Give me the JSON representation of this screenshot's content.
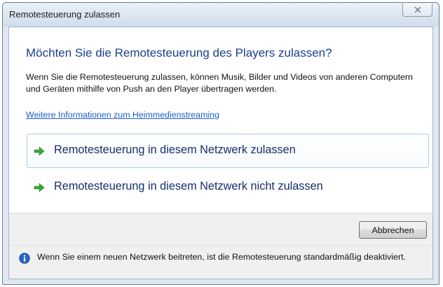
{
  "window": {
    "title": "Remotesteuerung zulassen",
    "close_icon": "close-icon"
  },
  "main": {
    "heading": "Möchten Sie die Remotesteuerung des Players zulassen?",
    "description": "Wenn Sie die Remotesteuerung zulassen, können Musik, Bilder und Videos von anderen Computern und Geräten mithilfe von Push an den Player übertragen werden.",
    "info_link": "Weitere Informationen zum Heimmedienstreaming",
    "options": [
      {
        "label": "Remotesteuerung in diesem Netzwerk zulassen",
        "icon": "green-arrow-icon"
      },
      {
        "label": "Remotesteuerung in diesem Netzwerk nicht zulassen",
        "icon": "green-arrow-icon"
      }
    ]
  },
  "commands": {
    "cancel_label": "Abbrechen"
  },
  "footer": {
    "icon": "info-icon",
    "note": "Wenn Sie einem neuen Netzwerk beitreten, ist die Remotesteuerung standardmäßig deaktiviert."
  },
  "colors": {
    "heading": "#1b3f8b",
    "link": "#1d5ec7",
    "option_text": "#152f6c",
    "arrow_green": "#3aa53a",
    "info_blue": "#2a63c4",
    "footer_bg": "#f0f0f0"
  }
}
